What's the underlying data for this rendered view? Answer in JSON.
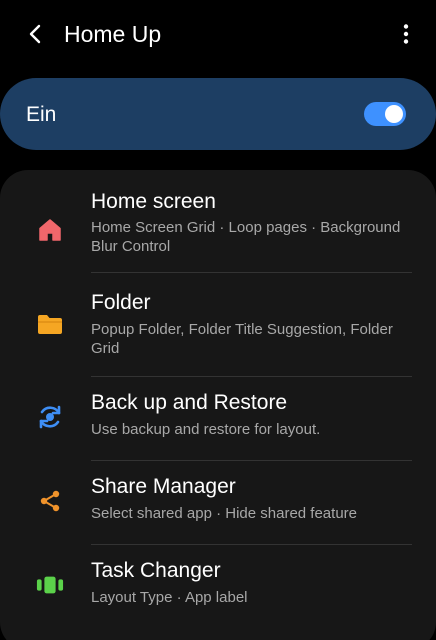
{
  "header": {
    "title": "Home Up",
    "back_icon": "chevron-left-icon",
    "more_icon": "more-vertical-icon"
  },
  "master_switch": {
    "label": "Ein",
    "state": "on",
    "accent_color": "#3e91ff",
    "background_color": "#1d3e63"
  },
  "items": [
    {
      "title": "Home screen",
      "subtitle": "Home Screen Grid · Loop pages · Background Blur Control",
      "icon": "home-icon",
      "icon_color": "#f0676b"
    },
    {
      "title": "Folder",
      "subtitle": "Popup Folder, Folder Title Suggestion, Folder Grid",
      "icon": "folder-icon",
      "icon_color": "#f5a623"
    },
    {
      "title": "Back up and Restore",
      "subtitle": "Use backup and restore for layout.",
      "icon": "backup-restore-icon",
      "icon_color": "#3e8ef5"
    },
    {
      "title": "Share Manager",
      "subtitle": "Select shared app · Hide shared feature",
      "icon": "share-icon",
      "icon_color": "#f0932b"
    },
    {
      "title": "Task Changer",
      "subtitle": "Layout Type · App label",
      "icon": "task-changer-icon",
      "icon_color": "#5bd24a"
    }
  ]
}
